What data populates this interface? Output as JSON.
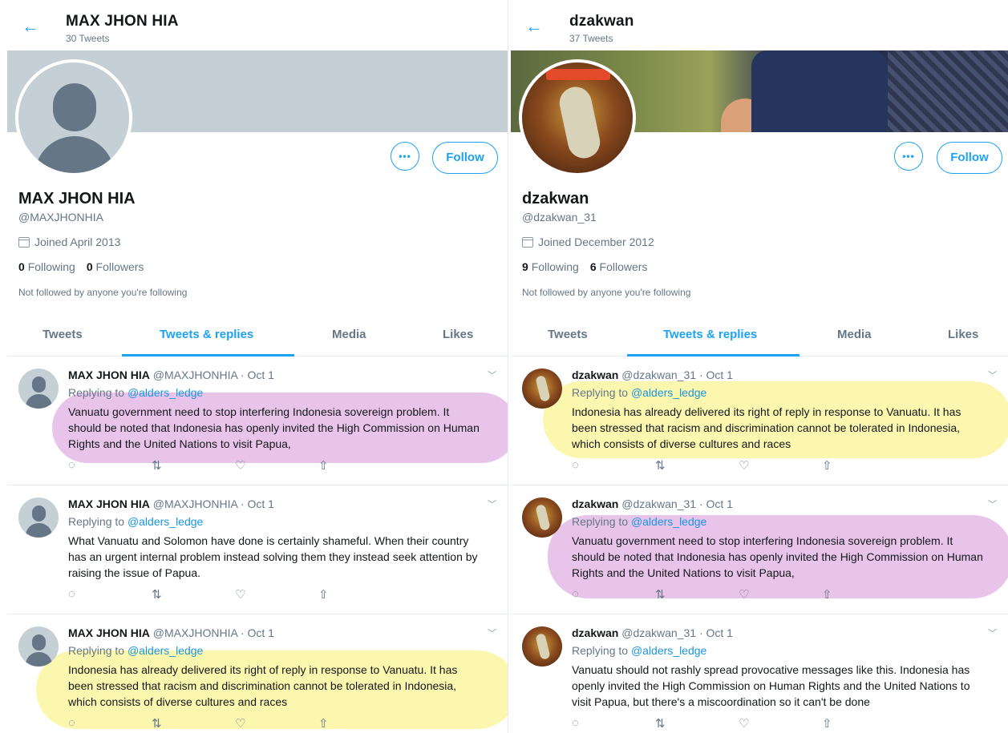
{
  "colors": {
    "accent": "#1da1f2",
    "highlight_purple": "#e1b3e5",
    "highlight_yellow": "#f9f39a"
  },
  "left": {
    "header": {
      "back_icon": "back-arrow-icon",
      "name": "MAX JHON HIA",
      "tweet_count": "30 Tweets"
    },
    "profile": {
      "more_label": "•••",
      "follow_label": "Follow",
      "name": "MAX JHON HIA",
      "handle": "@MAXJHONHIA",
      "joined": "Joined April 2013",
      "following_count": "0",
      "following_label": "Following",
      "followers_count": "0",
      "followers_label": "Followers",
      "not_followed": "Not followed by anyone you're following"
    },
    "tabs": [
      "Tweets",
      "Tweets & replies",
      "Media",
      "Likes"
    ],
    "active_tab": "Tweets & replies",
    "tweets": [
      {
        "name": "MAX JHON HIA",
        "meta": "@MAXJHONHIA · Oct 1",
        "replying": "Replying to",
        "mention": "@alders_ledge",
        "text": "Vanuatu government need to stop interfering Indonesia sovereign problem. It should be noted that Indonesia has openly invited the High Commission on Human Rights and the United Nations to visit Papua,",
        "highlight": "purple"
      },
      {
        "name": "MAX JHON HIA",
        "meta": "@MAXJHONHIA · Oct 1",
        "replying": "Replying to",
        "mention": "@alders_ledge",
        "text": "What Vanuatu and Solomon have done is certainly shameful. When their country has an urgent internal problem instead solving them they instead seek attention by raising the issue of Papua.",
        "highlight": "none"
      },
      {
        "name": "MAX JHON HIA",
        "meta": "@MAXJHONHIA · Oct 1",
        "replying": "Replying to",
        "mention": "@alders_ledge",
        "text": "Indonesia has already delivered its right of reply in response to Vanuatu. It has been stressed that racism and discrimination cannot be tolerated in Indonesia, which consists of diverse cultures and races",
        "highlight": "yellow"
      }
    ]
  },
  "right": {
    "header": {
      "back_icon": "back-arrow-icon",
      "name": "dzakwan",
      "tweet_count": "37 Tweets"
    },
    "profile": {
      "more_label": "•••",
      "follow_label": "Follow",
      "name": "dzakwan",
      "handle": "@dzakwan_31",
      "joined": "Joined December 2012",
      "following_count": "9",
      "following_label": "Following",
      "followers_count": "6",
      "followers_label": "Followers",
      "not_followed": "Not followed by anyone you're following"
    },
    "tabs": [
      "Tweets",
      "Tweets & replies",
      "Media",
      "Likes"
    ],
    "active_tab": "Tweets & replies",
    "tweets": [
      {
        "name": "dzakwan",
        "meta": "@dzakwan_31 · Oct 1",
        "replying": "Replying to",
        "mention": "@alders_ledge",
        "text": "Indonesia has already delivered its right of reply in response to Vanuatu. It has been stressed that racism and discrimination cannot be tolerated in Indonesia, which consists of diverse cultures and races",
        "highlight": "yellow"
      },
      {
        "name": "dzakwan",
        "meta": "@dzakwan_31 · Oct 1",
        "replying": "Replying to",
        "mention": "@alders_ledge",
        "text": "Vanuatu government need to stop interfering Indonesia sovereign problem. It should be noted that Indonesia has openly invited the High Commission on Human Rights and the United Nations to visit Papua,",
        "highlight": "purple"
      },
      {
        "name": "dzakwan",
        "meta": "@dzakwan_31 · Oct 1",
        "replying": "Replying to",
        "mention": "@alders_ledge",
        "text": "Vanuatu should not rashly spread provocative messages like this. Indonesia has openly invited the High Commission on Human Rights and the United Nations to visit Papua, but there's a miscoordination so it can't be done",
        "highlight": "none"
      }
    ]
  },
  "tweet_actions": [
    "reply-icon",
    "retweet-icon",
    "like-icon",
    "share-icon"
  ]
}
